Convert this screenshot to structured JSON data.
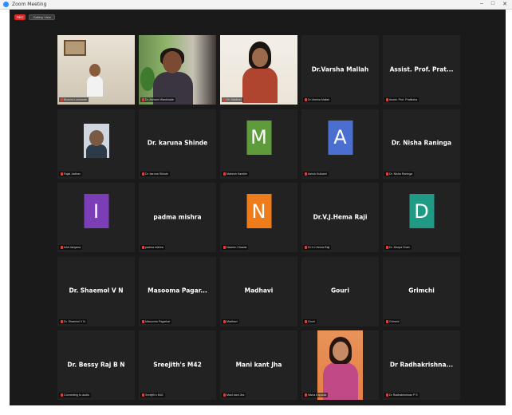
{
  "window": {
    "title": "Zoom Meeting",
    "controls": [
      "–",
      "□",
      "✕"
    ]
  },
  "topbar": {
    "rec_label": "REC",
    "speaker_view_label": "Gallery View"
  },
  "colors": {
    "active_border": "#a8d24a",
    "muted_mic": "#e0413b",
    "tile_bg": "#222222"
  },
  "tiles": [
    {
      "type": "video",
      "video_class": "v1",
      "label": "Bhavna Lokhande"
    },
    {
      "type": "video",
      "video_class": "v2",
      "label": "Dr. Ashwini Wankhade"
    },
    {
      "type": "video",
      "video_class": "v3",
      "label": "Dr. Madhuri",
      "active": true
    },
    {
      "type": "name",
      "name": "Dr.Varsha Mallah",
      "label": "Dr.Varsha Mallah"
    },
    {
      "type": "name",
      "name": "Assist. Prof. Prat...",
      "label": "Assist. Prof. Pratiksha"
    },
    {
      "type": "video",
      "video_class": "v4",
      "label": "Rajat Jadhav"
    },
    {
      "type": "name",
      "name": "Dr. karuna Shinde",
      "label": "Dr. karuna Shinde"
    },
    {
      "type": "letter",
      "letter": "M",
      "color": "#5d9b3b",
      "label": "Mahesh Kamble"
    },
    {
      "type": "letter",
      "letter": "A",
      "color": "#4b6fd1",
      "label": "Ashok Kulkarni"
    },
    {
      "type": "name",
      "name": "Dr. Nisha Raninga",
      "label": "Dr. Nisha Raninga"
    },
    {
      "type": "letter",
      "letter": "I",
      "color": "#7c3eb6",
      "label": "Ishit Jariyava"
    },
    {
      "type": "name",
      "name": "padma mishra",
      "label": "padma mishra"
    },
    {
      "type": "letter",
      "letter": "N",
      "color": "#ef7c1b",
      "label": "Naveen Chawla"
    },
    {
      "type": "name",
      "name": "Dr.V.J.Hema Raji",
      "label": "Dr.V.J.Hema Raji"
    },
    {
      "type": "letter",
      "letter": "D",
      "color": "#1f9a84",
      "label": "Dr. Deepa Shah"
    },
    {
      "type": "name",
      "name": "Dr. Shaemol V N",
      "label": "Dr. Shaemol V N"
    },
    {
      "type": "name",
      "name": "Masooma Pagar...",
      "label": "Masooma Pagarkar"
    },
    {
      "type": "name",
      "name": "Madhavi",
      "label": "Madhavi"
    },
    {
      "type": "name",
      "name": "Gouri",
      "label": "Gouri"
    },
    {
      "type": "name",
      "name": "Grimchi",
      "label": "Grimchi"
    },
    {
      "type": "name",
      "name": "Dr. Bessy Raj B N",
      "label": "Connecting to audio"
    },
    {
      "type": "name",
      "name": "Sreejith's M42",
      "label": "Sreejith's M42"
    },
    {
      "type": "name",
      "name": "Mani kant Jha",
      "label": "Mani kant Jha"
    },
    {
      "type": "video",
      "video_class": "v5",
      "label": "Nisha Kapadia"
    },
    {
      "type": "name",
      "name": "Dr Radhakrishna...",
      "label": "Dr Radhakrishnan P S"
    }
  ]
}
